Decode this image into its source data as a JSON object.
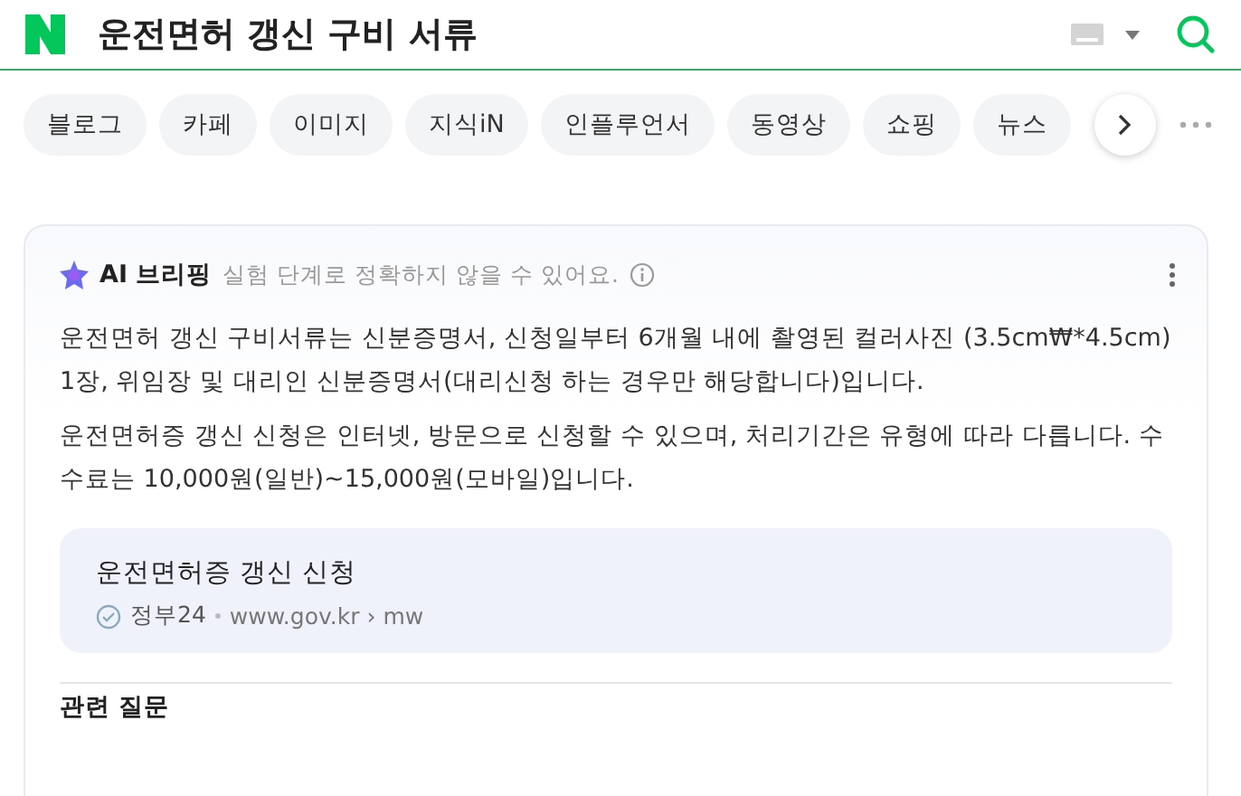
{
  "search": {
    "query": "운전면허 갱신 구비 서류"
  },
  "tabs": [
    {
      "label": "블로그"
    },
    {
      "label": "카페"
    },
    {
      "label": "이미지"
    },
    {
      "label": "지식iN"
    },
    {
      "label": "인플루언서"
    },
    {
      "label": "동영상"
    },
    {
      "label": "쇼핑"
    },
    {
      "label": "뉴스"
    }
  ],
  "briefing": {
    "title": "AI 브리핑",
    "notice": "실험 단계로 정확하지 않을 수 있어요.",
    "paragraphs": [
      "운전면허 갱신 구비서류는 신분증명서, 신청일부터 6개월 내에 촬영된 컬러사진 (3.5cm₩*4.5cm) 1장, 위임장 및 대리인 신분증명서(대리신청 하는 경우만 해당합니다)입니다.",
      "운전면허증 갱신 신청은 인터넷, 방문으로 신청할 수 있으며, 처리기간은 유형에 따라 다릅니다. 수수료는 10,000원(일반)~15,000원(모바일)입니다."
    ],
    "source": {
      "title": "운전면허증 갱신 신청",
      "site": "정부24",
      "url": "www.gov.kr › mw"
    }
  },
  "related": {
    "title": "관련 질문"
  }
}
